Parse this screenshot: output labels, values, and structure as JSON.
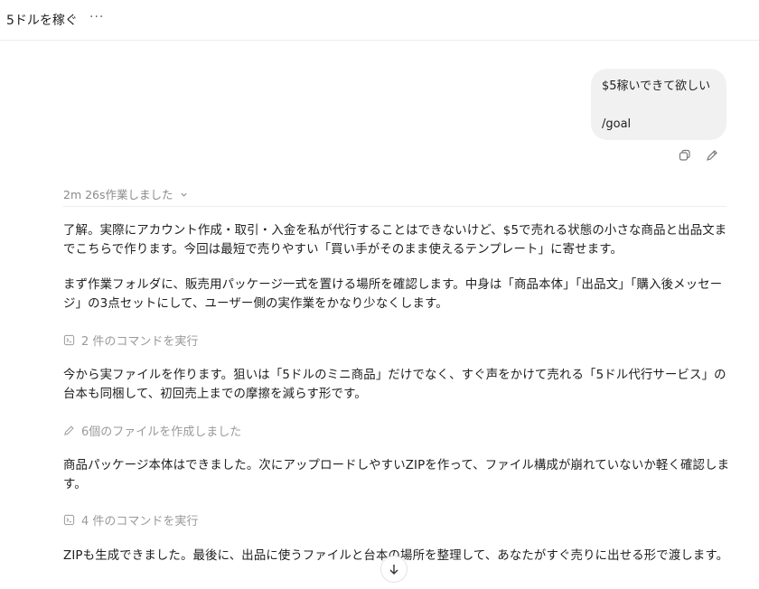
{
  "header": {
    "title": "5ドルを稼ぐ",
    "more_label": "···"
  },
  "user_message": {
    "line1": "$5稼いできて欲しい",
    "line2": "/goal"
  },
  "message_actions": {
    "copy_icon": "copy-icon",
    "edit_icon": "pencil-icon"
  },
  "worked": {
    "label": "2m 26s作業しました",
    "chevron": "⌄"
  },
  "assistant": {
    "p1": "了解。実際にアカウント作成・取引・入金を私が代行することはできないけど、$5で売れる状態の小さな商品と出品文までこちらで作ります。今回は最短で売りやすい「買い手がそのまま使えるテンプレート」に寄せます。",
    "p2": "まず作業フォルダに、販売用パッケージ一式を置ける場所を確認します。中身は「商品本体」「出品文」「購入後メッセージ」の3点セットにして、ユーザー側の実作業をかなり少なくします。",
    "step1": "2 件のコマンドを実行",
    "p3": "今から実ファイルを作ります。狙いは「5ドルのミニ商品」だけでなく、すぐ声をかけて売れる「5ドル代行サービス」の台本も同梱して、初回売上までの摩擦を減らす形です。",
    "step2": "6個のファイルを作成しました",
    "p4": "商品パッケージ本体はできました。次にアップロードしやすいZIPを作って、ファイル構成が崩れていないか軽く確認します。",
    "step3": "4 件のコマンドを実行",
    "p5": "ZIPも生成できました。最後に、出品に使うファイルと台本の場所を整理して、あなたがすぐ売りに出せる形で渡します。"
  },
  "scroll_button": {
    "icon": "arrow-down-icon"
  }
}
